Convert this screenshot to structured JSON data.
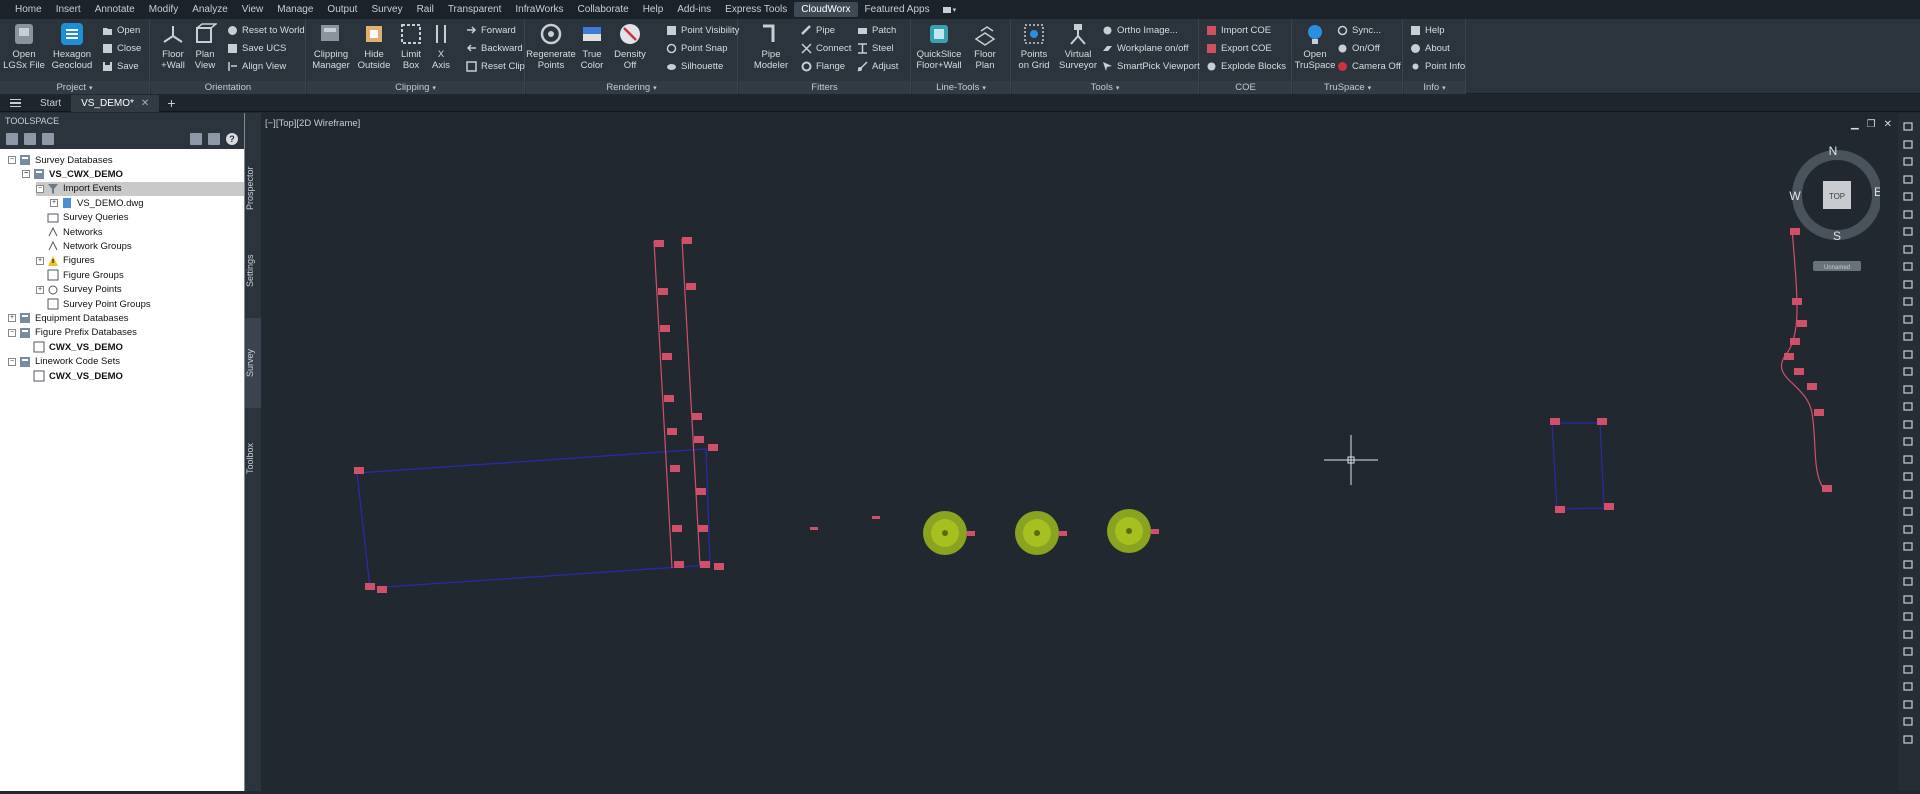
{
  "tabs": [
    "Home",
    "Insert",
    "Annotate",
    "Modify",
    "Analyze",
    "View",
    "Manage",
    "Output",
    "Survey",
    "Rail",
    "Transparent",
    "InfraWorks",
    "Collaborate",
    "Help",
    "Add-ins",
    "Express Tools",
    "CloudWorx",
    "Featured Apps"
  ],
  "active_tab": "CloudWorx",
  "ribbon": {
    "project": {
      "title": "Project",
      "open_lgsx": "Open\nLGSx File",
      "hexagon": "Hexagon\nGeocloud",
      "open": "Open",
      "close": "Close",
      "save": "Save"
    },
    "orientation": {
      "title": "Orientation",
      "floor_wall": "Floor\n+Wall",
      "plan_view": "Plan\nView",
      "reset_world": "Reset to World",
      "save_ucs": "Save UCS",
      "align_view": "Align View"
    },
    "clipping": {
      "title": "Clipping",
      "clip_manager": "Clipping\nManager",
      "hide_outside": "Hide\nOutside",
      "limit_box": "Limit\nBox",
      "x_axis": "X\nAxis",
      "forward": "Forward",
      "backward": "Backward",
      "reset_clip": "Reset Clip"
    },
    "rendering": {
      "title": "Rendering",
      "regen": "Regenerate\nPoints",
      "true_color": "True\nColor",
      "density": "Density\nOff",
      "point_visibility": "Point Visibility",
      "point_snap": "Point Snap",
      "silhouette": "Silhouette"
    },
    "fitters": {
      "title": "Fitters",
      "pipe_modeler": "Pipe\nModeler",
      "pipe": "Pipe",
      "connect": "Connect",
      "flange": "Flange",
      "patch": "Patch",
      "steel": "Steel",
      "adjust": "Adjust"
    },
    "linetools": {
      "title": "Line-Tools",
      "quickslice": "QuickSlice\nFloor+Wall",
      "floor_plan": "Floor\nPlan"
    },
    "tools": {
      "title": "Tools",
      "points_grid": "Points\non Grid",
      "virtual_surveyor": "Virtual\nSurveyor",
      "ortho": "Ortho Image...",
      "workplane": "Workplane on/off",
      "smartpick": "SmartPick Viewport"
    },
    "coe": {
      "title": "COE",
      "import": "Import COE",
      "export": "Export COE",
      "explode": "Explode Blocks"
    },
    "truspace": {
      "title": "TruSpace",
      "open": "Open\nTruSpace",
      "sync": "Sync...",
      "onoff": "On/Off",
      "camera": "Camera Off"
    },
    "info": {
      "title": "Info",
      "help": "Help",
      "about": "About",
      "point_info": "Point Info"
    }
  },
  "file_tabs": {
    "start": "Start",
    "doc": "VS_DEMO*"
  },
  "toolspace": {
    "title": "TOOLSPACE",
    "tree": [
      "Survey Databases",
      "VS_CWX_DEMO",
      "Import Events",
      "VS_DEMO.dwg",
      "Survey Queries",
      "Networks",
      "Network Groups",
      "Figures",
      "Figure Groups",
      "Survey Points",
      "Survey Point Groups",
      "Equipment Databases",
      "Figure Prefix Databases",
      "CWX_VS_DEMO",
      "Linework Code Sets",
      "CWX_VS_DEMO"
    ]
  },
  "side_tabs": [
    "Prospector",
    "Settings",
    "Survey",
    "Toolbox"
  ],
  "viewport": {
    "label": "[−][Top][2D Wireframe]",
    "viewcube": {
      "n": "N",
      "s": "S",
      "e": "E",
      "w": "W",
      "top": "TOP",
      "wcs": "Unnamed"
    }
  },
  "colors": {
    "accent": "#4a5a6b",
    "line_red": "#d0506a",
    "line_blue": "#2a2aa8",
    "tree_green": "#a6c020"
  }
}
